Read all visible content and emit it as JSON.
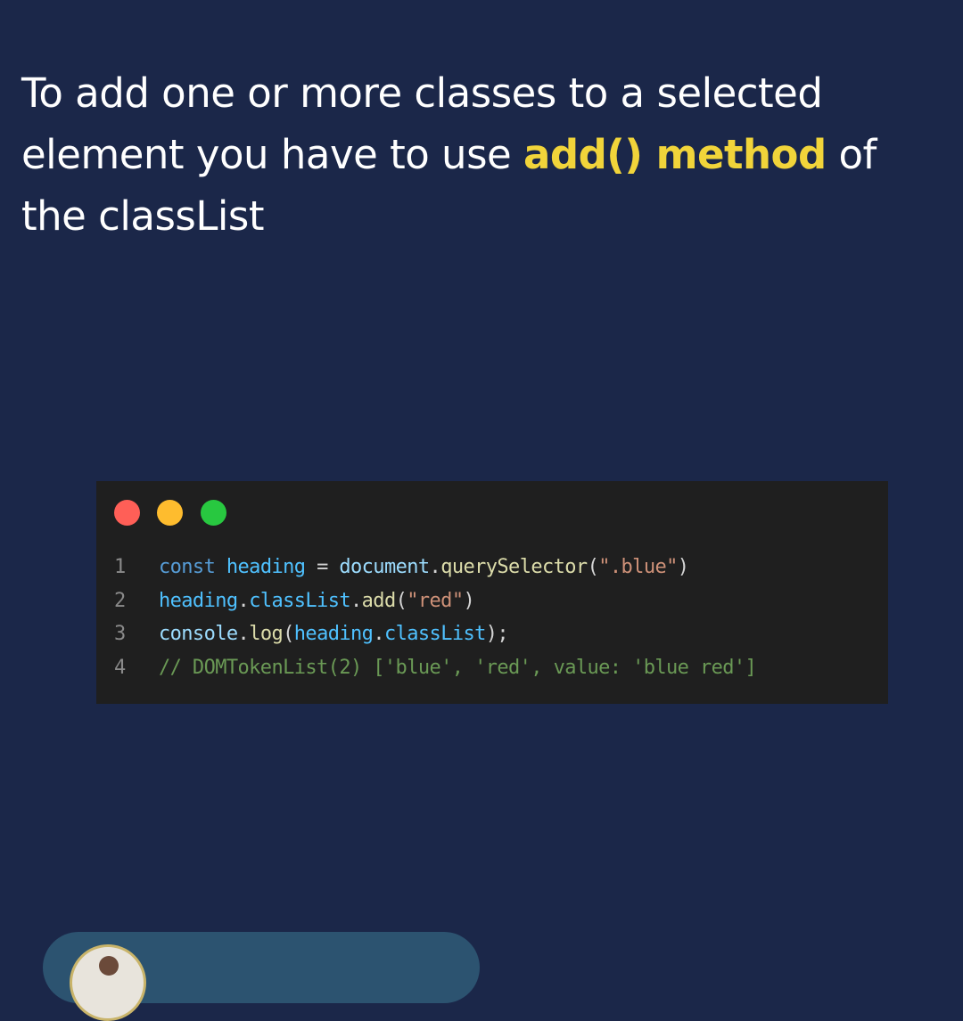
{
  "headline": {
    "before": "To add one or more classes to a selected element you have to use ",
    "highlight": "add() method",
    "after": " of the classList"
  },
  "colors": {
    "background": "#1b2749",
    "highlight": "#f1d43a",
    "code_background": "#1f1f1f",
    "dot_red": "#ff5f57",
    "dot_yellow": "#febc2e",
    "dot_green": "#28c840",
    "card": "#2c5370"
  },
  "code_window": {
    "window_buttons": [
      "close-dot",
      "minimize-dot",
      "maximize-dot"
    ],
    "lines": [
      {
        "number": "1",
        "tokens": [
          {
            "t": "const",
            "c": "kw"
          },
          {
            "t": " ",
            "c": "pn"
          },
          {
            "t": "heading",
            "c": "var"
          },
          {
            "t": " = ",
            "c": "pn"
          },
          {
            "t": "document",
            "c": "ident"
          },
          {
            "t": ".",
            "c": "pn"
          },
          {
            "t": "querySelector",
            "c": "fn"
          },
          {
            "t": "(",
            "c": "pn"
          },
          {
            "t": "\".blue\"",
            "c": "str"
          },
          {
            "t": ")",
            "c": "pn"
          }
        ]
      },
      {
        "number": "2",
        "tokens": [
          {
            "t": "heading",
            "c": "var"
          },
          {
            "t": ".",
            "c": "pn"
          },
          {
            "t": "classList",
            "c": "var"
          },
          {
            "t": ".",
            "c": "pn"
          },
          {
            "t": "add",
            "c": "fn"
          },
          {
            "t": "(",
            "c": "pn"
          },
          {
            "t": "\"red\"",
            "c": "str"
          },
          {
            "t": ")",
            "c": "pn"
          }
        ]
      },
      {
        "number": "3",
        "tokens": [
          {
            "t": "console",
            "c": "ident"
          },
          {
            "t": ".",
            "c": "pn"
          },
          {
            "t": "log",
            "c": "fn"
          },
          {
            "t": "(",
            "c": "pn"
          },
          {
            "t": "heading",
            "c": "var"
          },
          {
            "t": ".",
            "c": "pn"
          },
          {
            "t": "classList",
            "c": "var"
          },
          {
            "t": ");",
            "c": "pn"
          }
        ]
      },
      {
        "number": "4",
        "tokens": [
          {
            "t": "// DOMTokenList(2) ['blue', 'red', value: 'blue red']",
            "c": "cmt"
          }
        ]
      }
    ]
  },
  "author_card": {
    "avatar": "author-avatar"
  }
}
